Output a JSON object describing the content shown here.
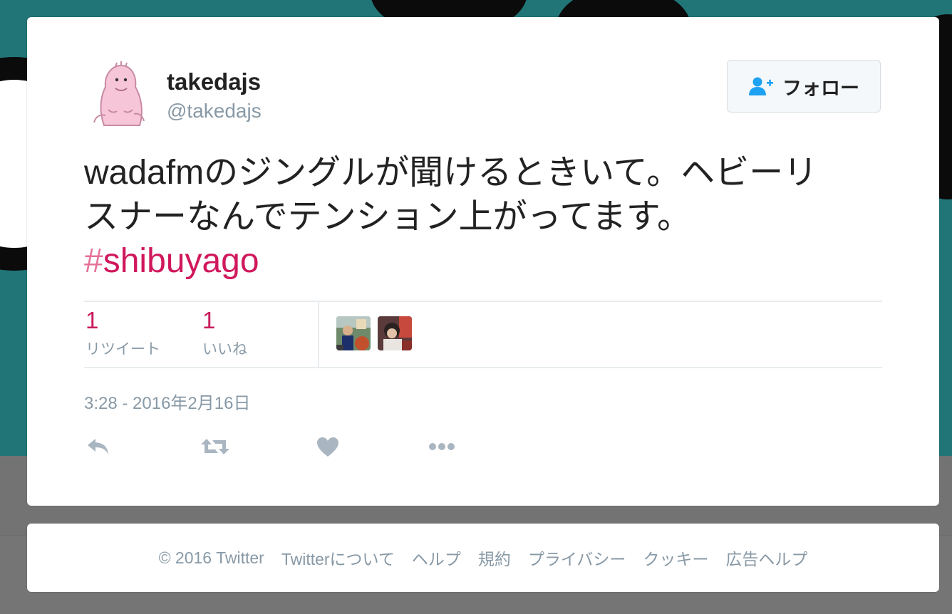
{
  "user": {
    "name": "takedajs",
    "screen_name": "@takedajs"
  },
  "follow_button": {
    "label": "フォロー"
  },
  "tweet": {
    "text_line1": "wadafmのジングルが聞けるときいて。ヘビーリ",
    "text_line2": "スナーなんでテンション上がってます。",
    "hashtag_symbol": "#",
    "hashtag_text": "shibuyago",
    "timestamp": "3:28 - 2016年2月16日"
  },
  "stats": {
    "retweets": {
      "value": "1",
      "label": "リツイート"
    },
    "likes": {
      "value": "1",
      "label": "いいね"
    }
  },
  "actions": [
    {
      "icon": "reply-icon"
    },
    {
      "icon": "retweet-icon"
    },
    {
      "icon": "heart-icon"
    },
    {
      "icon": "more-icon"
    }
  ],
  "footer": {
    "copyright": "© 2016 Twitter",
    "links": [
      "Twitterについて",
      "ヘルプ",
      "規約",
      "プライバシー",
      "クッキー",
      "広告ヘルプ"
    ]
  },
  "colors": {
    "accent": "#c81b5c",
    "secondary_text": "#8899a6",
    "follow_icon": "#1da1f2",
    "backdrop_teal": "#217577",
    "backdrop_grey": "#7a7a7a"
  }
}
